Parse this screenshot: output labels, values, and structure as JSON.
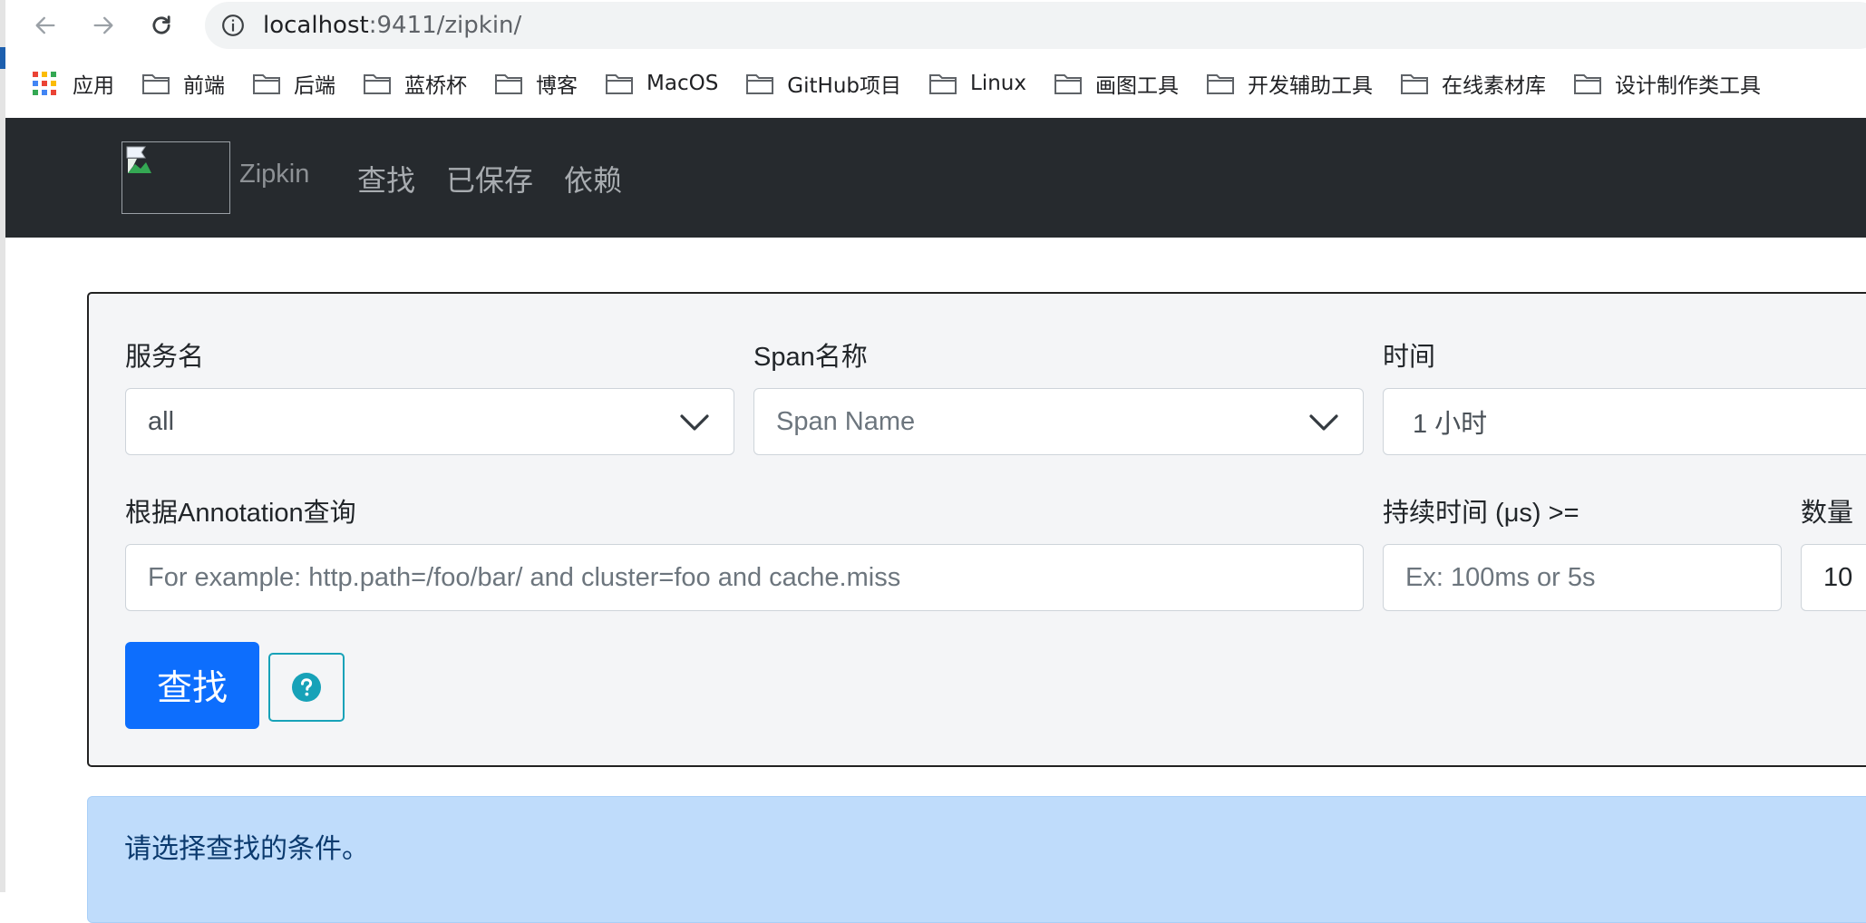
{
  "browser": {
    "url_host": "localhost",
    "url_path": ":9411/zipkin/",
    "apps_label": "应用",
    "bookmarks": [
      "前端",
      "后端",
      "蓝桥杯",
      "博客",
      "MacOS",
      "GitHub项目",
      "Linux",
      "画图工具",
      "开发辅助工具",
      "在线素材库",
      "设计制作类工具"
    ],
    "icons": {
      "back": "back-arrow-icon",
      "forward": "forward-arrow-icon",
      "reload": "reload-icon",
      "info": "info-circle-icon",
      "folder": "folder-icon",
      "apps": "apps-grid-icon"
    }
  },
  "navbar": {
    "brand": "Zipkin",
    "links": [
      "查找",
      "已保存",
      "依赖"
    ],
    "bg_color": "#262a2e"
  },
  "search": {
    "service_label": "服务名",
    "service_value": "all",
    "span_label": "Span名称",
    "span_placeholder": "Span Name",
    "time_label": "时间",
    "time_value": "1 小时",
    "annotation_label": "根据Annotation查询",
    "annotation_placeholder": "For example: http.path=/foo/bar/ and cluster=foo and cache.miss",
    "duration_label": "持续时间 (μs) >=",
    "duration_placeholder": "Ex: 100ms or 5s",
    "limit_label": "数量",
    "limit_value": "10",
    "submit_label": "查找",
    "help_icon": "question-circle-icon",
    "primary_color": "#0d6efd",
    "help_color": "#17a2b8"
  },
  "alert": {
    "message": "请选择查找的条件。",
    "bg_color": "#bfdcfb"
  }
}
